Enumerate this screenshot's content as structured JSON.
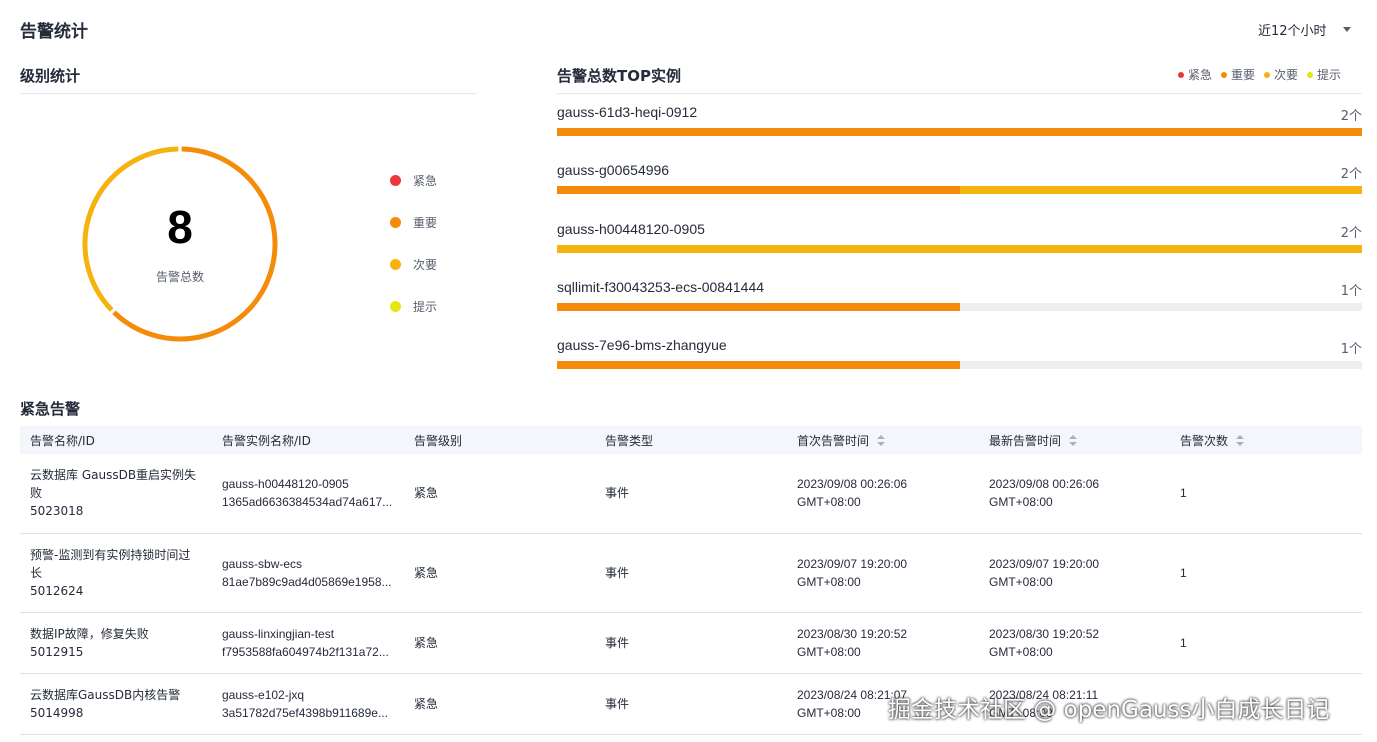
{
  "header": {
    "title": "告警统计",
    "time_range": "近12个小时"
  },
  "level_stats": {
    "title": "级别统计",
    "total": "8",
    "total_label": "告警总数",
    "legend": [
      {
        "label": "紧急",
        "color": "#e8383d"
      },
      {
        "label": "重要",
        "color": "#f58b0a"
      },
      {
        "label": "次要",
        "color": "#f6b20f"
      },
      {
        "label": "提示",
        "color": "#e6e612"
      }
    ],
    "slices": [
      {
        "level": "重要",
        "value": 5,
        "color": "#f58b0a"
      },
      {
        "level": "次要",
        "value": 3,
        "color": "#f6b20f"
      }
    ]
  },
  "top_instances": {
    "title": "告警总数TOP实例",
    "legend": [
      {
        "label": "紧急",
        "color": "#e8383d"
      },
      {
        "label": "重要",
        "color": "#f58b0a"
      },
      {
        "label": "次要",
        "color": "#f6b20f"
      },
      {
        "label": "提示",
        "color": "#e6e612"
      }
    ],
    "max": 2,
    "rows": [
      {
        "name": "gauss-61d3-heqi-0912",
        "count": "2个",
        "segments": [
          {
            "value": 2,
            "color": "#f58b0a"
          }
        ]
      },
      {
        "name": "gauss-g00654996",
        "count": "2个",
        "segments": [
          {
            "value": 1,
            "color": "#f58b0a"
          },
          {
            "value": 1,
            "color": "#f6b20f"
          }
        ]
      },
      {
        "name": "gauss-h00448120-0905",
        "count": "2个",
        "segments": [
          {
            "value": 2,
            "color": "#f6b20f"
          }
        ]
      },
      {
        "name": "sqllimit-f30043253-ecs-00841444",
        "count": "1个",
        "segments": [
          {
            "value": 1,
            "color": "#f58b0a"
          }
        ]
      },
      {
        "name": "gauss-7e96-bms-zhangyue",
        "count": "1个",
        "segments": [
          {
            "value": 1,
            "color": "#f58b0a"
          }
        ]
      }
    ]
  },
  "urgent": {
    "title": "紧急告警",
    "columns": [
      "告警名称/ID",
      "告警实例名称/ID",
      "告警级别",
      "告警类型",
      "首次告警时间",
      "最新告警时间",
      "告警次数"
    ],
    "rows": [
      {
        "name": "云数据库 GaussDB重启实例失败",
        "id": "5023018",
        "instance": "gauss-h00448120-0905",
        "instance_id": "1365ad6636384534ad74a617...",
        "level": "紧急",
        "type": "事件",
        "first": "2023/09/08  00:26:06  GMT+08:00",
        "latest": "2023/09/08  00:26:06  GMT+08:00",
        "count": "1"
      },
      {
        "name": "预警-监测到有实例持锁时间过长",
        "id": "5012624",
        "instance": "gauss-sbw-ecs",
        "instance_id": "81ae7b89c9ad4d05869e1958...",
        "level": "紧急",
        "type": "事件",
        "first": "2023/09/07  19:20:00  GMT+08:00",
        "latest": "2023/09/07  19:20:00  GMT+08:00",
        "count": "1"
      },
      {
        "name": "数据IP故障，修复失败",
        "id": "5012915",
        "instance": "gauss-linxingjian-test",
        "instance_id": "f7953588fa604974b2f131a72...",
        "level": "紧急",
        "type": "事件",
        "first": "2023/08/30  19:20:52  GMT+08:00",
        "latest": "2023/08/30  19:20:52  GMT+08:00",
        "count": "1"
      },
      {
        "name": "云数据库GaussDB内核告警",
        "id": "5014998",
        "instance": "gauss-e102-jxq",
        "instance_id": "3a51782d75ef4398b911689e...",
        "level": "紧急",
        "type": "事件",
        "first": "2023/08/24  08:21:07  GMT+08:00",
        "latest": "2023/08/24  08:21:11  GMT+08:00",
        "count": ""
      }
    ]
  },
  "watermark": "掘金技术社区 @ openGauss小白成长日记"
}
